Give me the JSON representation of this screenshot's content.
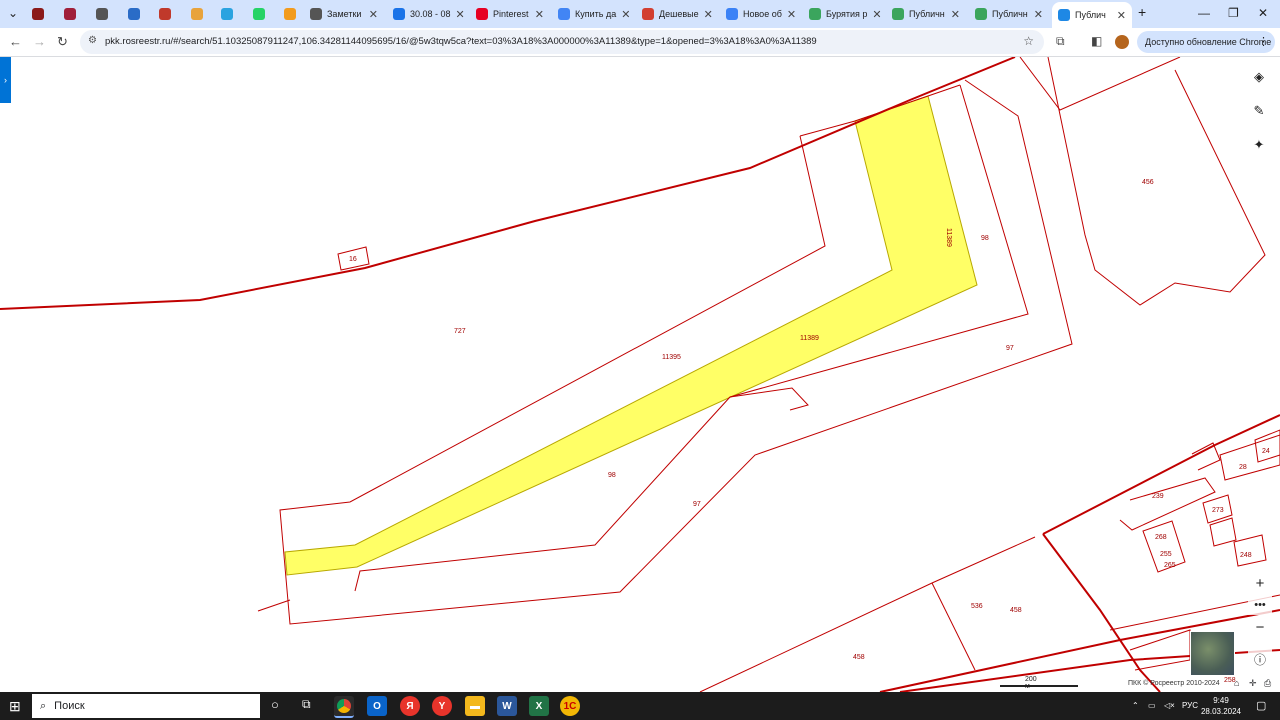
{
  "browser": {
    "tabs": [
      {
        "label": "",
        "icon": "site-icon",
        "color": "#8b1a1a"
      },
      {
        "label": "",
        "icon": "site-icon",
        "color": "#a01f3a"
      },
      {
        "label": "",
        "icon": "site-icon",
        "color": "#555555"
      },
      {
        "label": "",
        "icon": "site-icon",
        "color": "#2a6cc7"
      },
      {
        "label": "",
        "icon": "site-icon",
        "color": "#c0392b"
      },
      {
        "label": "",
        "icon": "site-icon",
        "color": "#e8a33b"
      },
      {
        "label": "",
        "icon": "telegram-icon",
        "color": "#2aa3e0"
      },
      {
        "label": "",
        "icon": "whatsapp-icon",
        "color": "#25d366"
      },
      {
        "label": "",
        "icon": "mail-icon",
        "color": "#f29b1d"
      },
      {
        "label": "Заметки",
        "icon": "apple-icon",
        "color": "#555555"
      },
      {
        "label": "30.08 - 08",
        "icon": "calendar-icon",
        "color": "#1a73e8"
      },
      {
        "label": "Pinterest",
        "icon": "pinterest-icon",
        "color": "#e60023"
      },
      {
        "label": "Купить да",
        "icon": "google-icon",
        "color": "#4285f4"
      },
      {
        "label": "Дешевые",
        "icon": "site-icon",
        "color": "#d23f31"
      },
      {
        "label": "Новое об",
        "icon": "site-icon",
        "color": "#3b82f6"
      },
      {
        "label": "Бурятия р",
        "icon": "check-icon",
        "color": "#3ba55d"
      },
      {
        "label": "Публичн",
        "icon": "check-icon",
        "color": "#3ba55d"
      },
      {
        "label": "Публичн",
        "icon": "check-icon",
        "color": "#3ba55d"
      },
      {
        "label": "Публич",
        "icon": "rosreestr-icon",
        "color": "#1e88e5",
        "active": true
      }
    ],
    "url": "pkk.rosreestr.ru/#/search/51.10325087911247,106.34281144095695/16/@5w3tqw5ca?text=03%3A18%3A000000%3A11389&type=1&opened=3%3A18%3A0%3A11389",
    "update_label": "Доступно обновление Chrome"
  },
  "map": {
    "parcel_color": "#ffff66",
    "boundary_color": "#c00000",
    "labels": {
      "l16": "16",
      "l727": "727",
      "l11395": "11395",
      "l11389": "11389",
      "l11389v": "11389",
      "l98a": "98",
      "l98b": "98",
      "l97a": "97",
      "l97b": "97",
      "l456": "456",
      "l239": "239",
      "l273": "273",
      "l268": "268",
      "l255": "255",
      "l265": "265",
      "l248": "248",
      "l536": "536",
      "l458a": "458",
      "l458b": "458",
      "l28": "28",
      "l24": "24",
      "l258": "258"
    },
    "scale": "200 м",
    "copyright": "ПКК © Росреестр 2010-2024"
  },
  "taskbar": {
    "search_label": "Поиск",
    "language": "РУС",
    "time": "9:49",
    "date": "28.03.2024"
  }
}
